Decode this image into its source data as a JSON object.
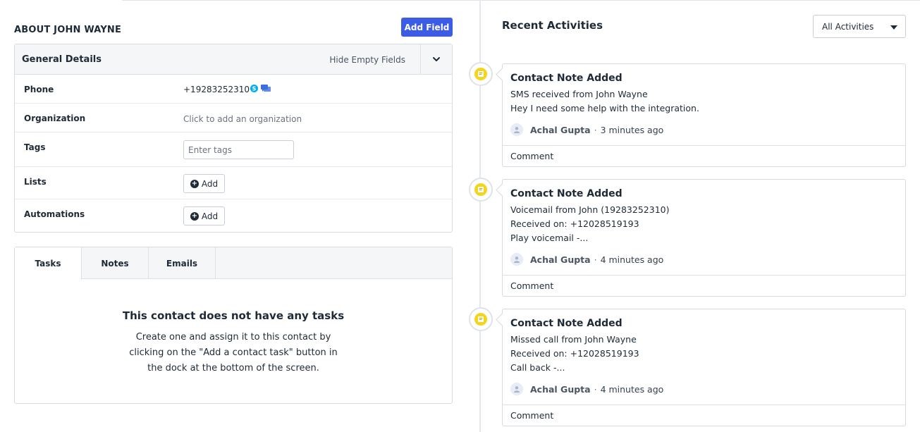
{
  "about": {
    "title": "ABOUT JOHN WAYNE",
    "add_field_label": "Add Field"
  },
  "general_details": {
    "title": "General Details",
    "hide_empty_label": "Hide Empty Fields",
    "fields": {
      "phone": {
        "label": "Phone",
        "value": "+19283252310"
      },
      "organization": {
        "label": "Organization",
        "value": "Click to add an organization"
      },
      "tags": {
        "label": "Tags",
        "placeholder": "Enter tags"
      },
      "lists": {
        "label": "Lists",
        "button": "Add"
      },
      "automations": {
        "label": "Automations",
        "button": "Add"
      }
    }
  },
  "tabs": {
    "items": [
      "Tasks",
      "Notes",
      "Emails"
    ],
    "active": "Tasks",
    "empty_title": "This contact does not have any tasks",
    "empty_text": "Create one and assign it to this contact by clicking on the \"Add a contact task\" button in the dock at the bottom of the screen."
  },
  "recent": {
    "title": "Recent Activities",
    "filter_value": "All Activities",
    "activities": [
      {
        "title": "Contact Note Added",
        "lines": [
          "SMS received from John Wayne",
          "Hey I need some help with the integration."
        ],
        "author": "Achal Gupta",
        "time": "3 minutes ago",
        "comment_label": "Comment"
      },
      {
        "title": "Contact Note Added",
        "lines": [
          "Voicemail from John (19283252310)",
          "Received on: +12028519193",
          "Play voicemail -..."
        ],
        "author": "Achal Gupta",
        "time": "4 minutes ago",
        "comment_label": "Comment"
      },
      {
        "title": "Contact Note Added",
        "lines": [
          "Missed call from John Wayne",
          "Received on: +12028519193",
          "Call back -..."
        ],
        "author": "Achal Gupta",
        "time": "4 minutes ago",
        "comment_label": "Comment"
      }
    ]
  },
  "colors": {
    "primary_button": "#3d5ce6",
    "note_icon": "#f4d51c",
    "skype_icon": "#00aff0",
    "chat_icon": "#3b6fe0"
  },
  "icons": {
    "collapse": "chevron-down-icon",
    "phone_call": "skype-icon",
    "phone_message": "chat-icon",
    "add": "plus-circle-icon",
    "activity": "note-icon",
    "author": "user-avatar-icon",
    "filter": "caret-down-icon"
  }
}
